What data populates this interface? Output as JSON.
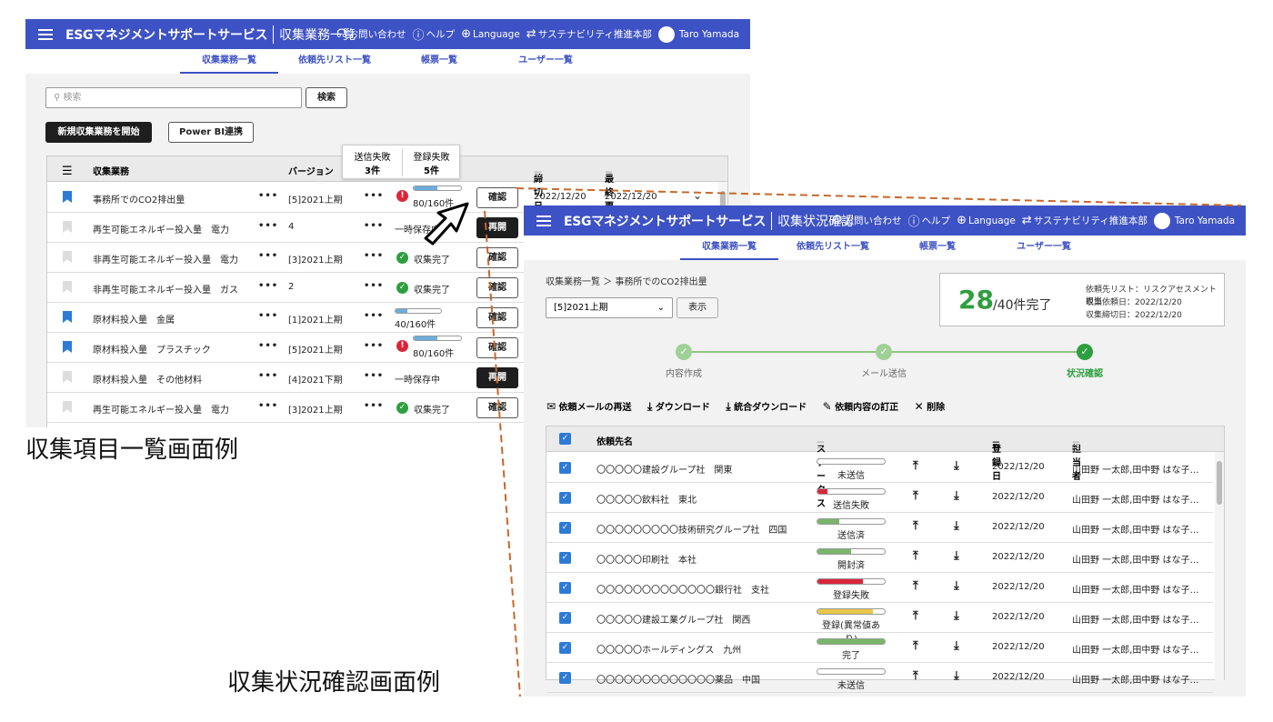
{
  "colors": {
    "header": "#3d52c4",
    "accent": "#2e7bd6",
    "success": "#2e9e3e",
    "error": "#d9263a",
    "warning": "#e8c84a",
    "sent": "#7ab56a",
    "progress": "#6baede",
    "dark_button": "#1e1e1e",
    "dashed_line": "#c8682a"
  },
  "common": {
    "app_title": "ESGマネジメントサポートサービス",
    "contact": "お問い合わせ",
    "help": "ヘルプ",
    "language": "Language",
    "department": "サステナビリティ推進本部",
    "user": "Taro Yamada",
    "tabs": [
      "収集業務一覧",
      "依頼先リスト一覧",
      "帳票一覧",
      "ユーザー一覧"
    ]
  },
  "screen1": {
    "page_title": "収集業務一覧",
    "search_placeholder": "検索",
    "search_button": "検索",
    "new_button": "新規収集業務を開始",
    "powerbi_button": "Power BI連携",
    "columns": {
      "task": "収集業務",
      "version": "バージョン",
      "deadline": "締切日",
      "updated": "最終更新日"
    },
    "tooltip": {
      "send_fail_label": "送信失敗",
      "send_fail_count": "3件",
      "reg_fail_label": "登録失敗",
      "reg_fail_count": "5件"
    },
    "rows": [
      {
        "bookmark": true,
        "name": "事務所でのCO2排出量",
        "version": "[5]2021上期",
        "status": "80/160件",
        "kind": "error-progress",
        "progress": 0.5,
        "button": "確認",
        "deadline": "2022/12/20",
        "updated": "2022/12/20"
      },
      {
        "bookmark": false,
        "name": "再生可能エネルギー投入量　電力",
        "version": "4",
        "status": "一時保存中",
        "kind": "text",
        "button": "再開"
      },
      {
        "bookmark": false,
        "name": "非再生可能エネルギー投入量　電力",
        "version": "[3]2021上期",
        "status": "収集完了",
        "kind": "ok",
        "button": "確認"
      },
      {
        "bookmark": false,
        "name": "非再生可能エネルギー投入量　ガス",
        "version": "2",
        "status": "収集完了",
        "kind": "ok",
        "button": "確認"
      },
      {
        "bookmark": true,
        "name": "原材料投入量　金属",
        "version": "[1]2021上期",
        "status": "40/160件",
        "kind": "progress",
        "progress": 0.25,
        "button": "確認"
      },
      {
        "bookmark": true,
        "name": "原材料投入量　プラスチック",
        "version": "[5]2021上期",
        "status": "80/160件",
        "kind": "error-progress",
        "progress": 0.5,
        "button": "確認"
      },
      {
        "bookmark": false,
        "name": "原材料投入量　その他材料",
        "version": "[4]2021下期",
        "status": "一時保存中",
        "kind": "text",
        "button": "再開"
      },
      {
        "bookmark": false,
        "name": "再生可能エネルギー投入量　電力",
        "version": "[3]2021上期",
        "status": "収集完了",
        "kind": "ok",
        "button": "確認"
      }
    ],
    "more": "•••",
    "caption": "収集項目一覧画面例"
  },
  "screen2": {
    "page_title": "収集状況確認",
    "breadcrumb": "収集業務一覧 ＞ 事務所でのCO2排出量",
    "version_select": "[5]2021上期",
    "show_button": "表示",
    "summary": {
      "done": "28",
      "total": "/40件完了",
      "list": "依頼先リスト：リスクアセスメント担当",
      "request_date": "収集依頼日：2022/12/20",
      "deadline": "収集締切日：2022/12/20"
    },
    "steps": [
      "内容作成",
      "メール送信",
      "状況確認"
    ],
    "actions": [
      "依頼メールの再送",
      "ダウンロード",
      "統合ダウンロード",
      "依頼内容の訂正",
      "削除"
    ],
    "columns": {
      "client": "依頼先名",
      "status": "ステータス",
      "date": "登録日",
      "person": "担当者"
    },
    "rows": [
      {
        "name": "〇〇〇〇〇建設グループ社　関東",
        "status": "未送信",
        "fill": 0,
        "color": "#ffffff",
        "date": "2022/12/20",
        "person": "山田野 一太郎,田中野 はな子…"
      },
      {
        "name": "〇〇〇〇〇飲料社　東北",
        "status": "送信失敗",
        "fill": 0.15,
        "color": "#d9263a",
        "date": "2022/12/20",
        "person": "山田野 一太郎,田中野 はな子…"
      },
      {
        "name": "〇〇〇〇〇〇〇〇〇技術研究グループ社　四国",
        "status": "送信済",
        "fill": 0.33,
        "color": "#7ab56a",
        "date": "2022/12/20",
        "person": "山田野 一太郎,田中野 はな子…"
      },
      {
        "name": "〇〇〇〇〇印刷社　本社",
        "status": "開封済",
        "fill": 0.5,
        "color": "#7ab56a",
        "date": "2022/12/20",
        "person": "山田野 一太郎,田中野 はな子…"
      },
      {
        "name": "〇〇〇〇〇〇〇〇〇〇〇〇〇銀行社　支社",
        "status": "登録失敗",
        "fill": 0.67,
        "color": "#d9263a",
        "date": "2022/12/20",
        "person": "山田野 一太郎,田中野 はな子…"
      },
      {
        "name": "〇〇〇〇〇建設工業グループ社　関西",
        "status": "登録(異常値あり)",
        "fill": 0.83,
        "color": "#e8c84a",
        "date": "2022/12/20",
        "person": "山田野 一太郎,田中野 はな子…"
      },
      {
        "name": "〇〇〇〇〇ホールディングス　九州",
        "status": "完了",
        "fill": 1,
        "color": "#7ab56a",
        "date": "2022/12/20",
        "person": "山田野 一太郎,田中野 はな子…"
      },
      {
        "name": "〇〇〇〇〇〇〇〇〇〇〇〇〇薬品　中国",
        "status": "未送信",
        "fill": 0,
        "color": "#ffffff",
        "date": "2022/12/20",
        "person": "山田野 一太郎,田中野 はな子…"
      }
    ],
    "caption": "収集状況確認画面例"
  }
}
